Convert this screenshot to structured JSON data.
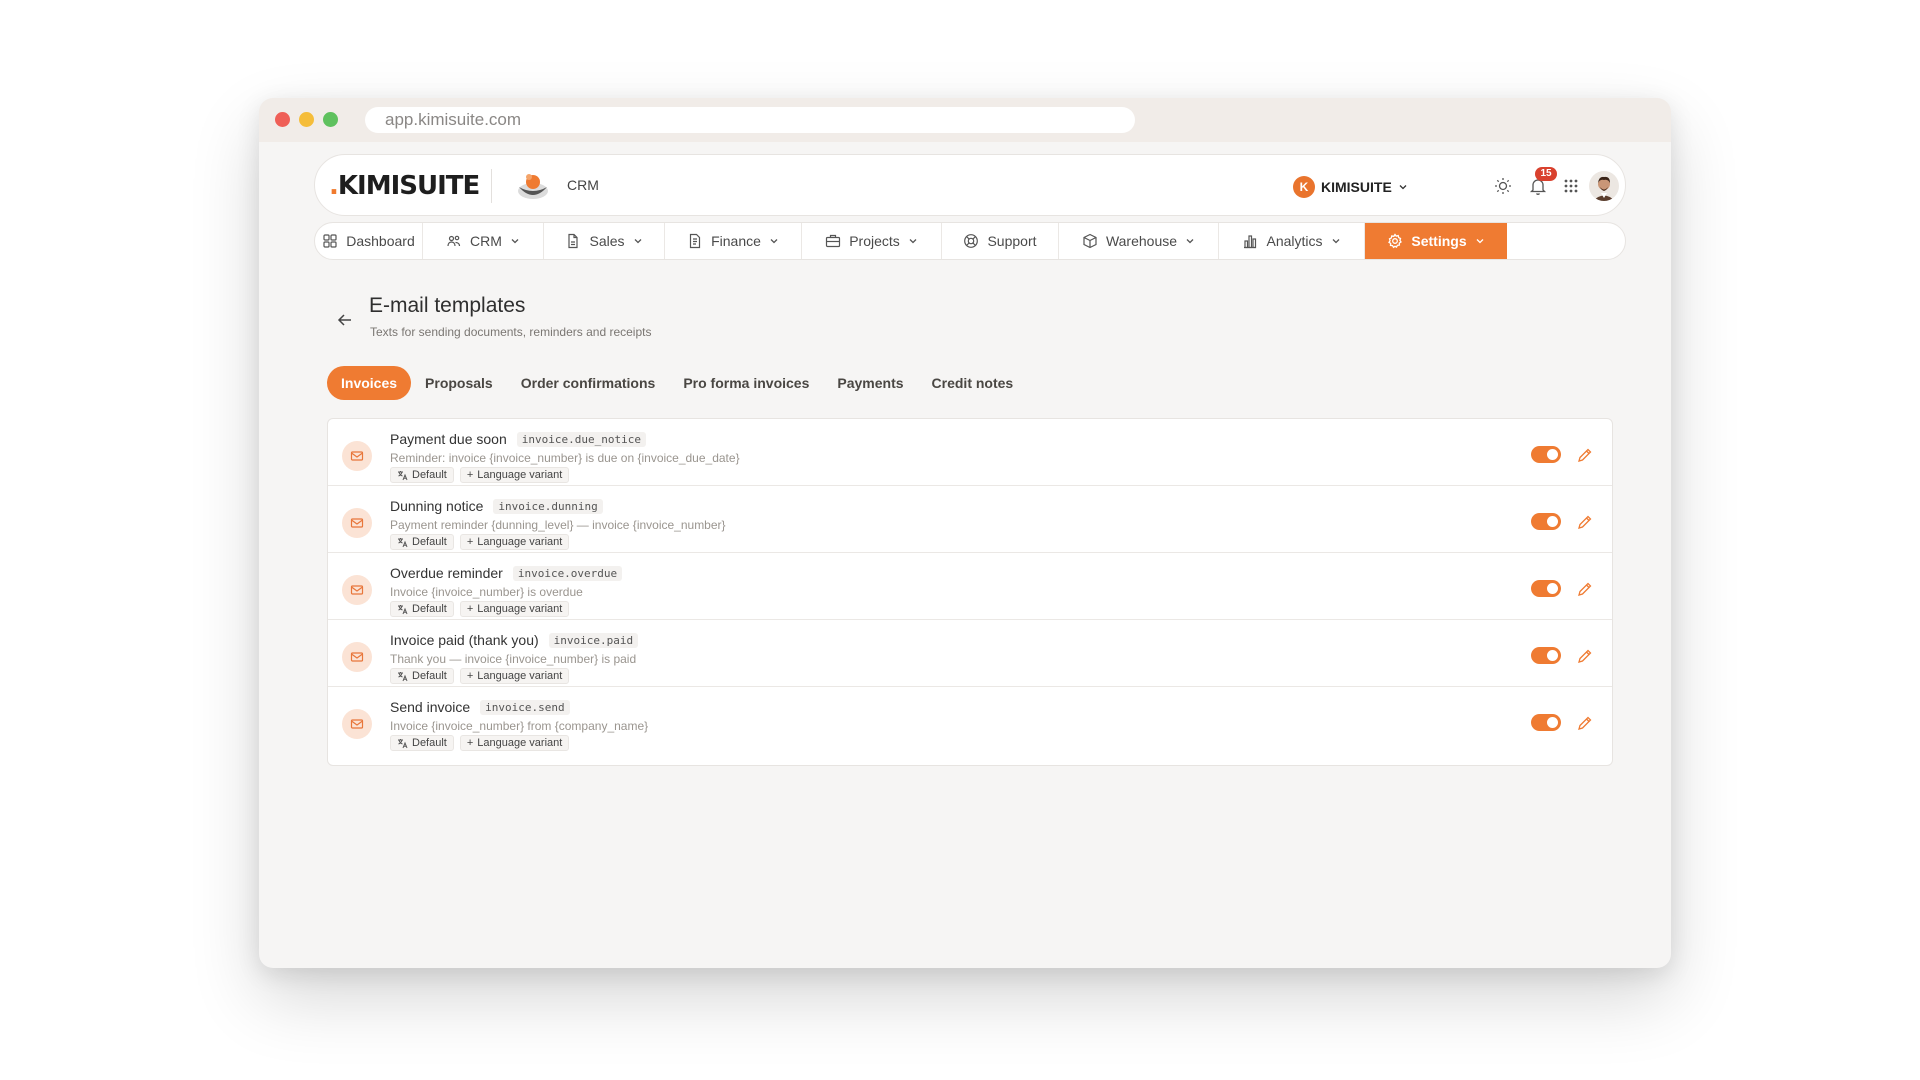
{
  "browser": {
    "url": "app.kimisuite.com"
  },
  "header": {
    "logo_dot": ".",
    "logo_text": "KIMISUITE",
    "app_label": "CRM",
    "tenant_initial": "K",
    "tenant_name": "KIMISUITE",
    "notification_count": "15"
  },
  "nav": {
    "items": [
      {
        "label": "Dashboard",
        "icon": "dashboard-icon",
        "dropdown": false
      },
      {
        "label": "CRM",
        "icon": "users-icon",
        "dropdown": true
      },
      {
        "label": "Sales",
        "icon": "document-icon",
        "dropdown": true
      },
      {
        "label": "Finance",
        "icon": "file-text-icon",
        "dropdown": true
      },
      {
        "label": "Projects",
        "icon": "briefcase-icon",
        "dropdown": true
      },
      {
        "label": "Support",
        "icon": "lifebuoy-icon",
        "dropdown": false
      },
      {
        "label": "Warehouse",
        "icon": "box-icon",
        "dropdown": true
      },
      {
        "label": "Analytics",
        "icon": "bar-chart-icon",
        "dropdown": true
      },
      {
        "label": "Settings",
        "icon": "gear-icon",
        "dropdown": true,
        "active": true
      }
    ]
  },
  "page": {
    "title": "E-mail templates",
    "subtitle": "Texts for sending documents, reminders and receipts"
  },
  "tabs": [
    {
      "label": "Invoices",
      "active": true
    },
    {
      "label": "Proposals"
    },
    {
      "label": "Order confirmations"
    },
    {
      "label": "Pro forma invoices"
    },
    {
      "label": "Payments"
    },
    {
      "label": "Credit notes"
    }
  ],
  "templates": [
    {
      "name": "Payment due soon",
      "code": "invoice.due_notice",
      "subject": "Reminder: invoice {invoice_number} is due on {invoice_due_date}",
      "default_label": "Default",
      "variant_label": "Language variant",
      "enabled": true
    },
    {
      "name": "Dunning notice",
      "code": "invoice.dunning",
      "subject": "Payment reminder {dunning_level} — invoice {invoice_number}",
      "default_label": "Default",
      "variant_label": "Language variant",
      "enabled": true
    },
    {
      "name": "Overdue reminder",
      "code": "invoice.overdue",
      "subject": "Invoice {invoice_number} is overdue",
      "default_label": "Default",
      "variant_label": "Language variant",
      "enabled": true
    },
    {
      "name": "Invoice paid (thank you)",
      "code": "invoice.paid",
      "subject": "Thank you — invoice {invoice_number} is paid",
      "default_label": "Default",
      "variant_label": "Language variant",
      "enabled": true
    },
    {
      "name": "Send invoice",
      "code": "invoice.send",
      "subject": "Invoice {invoice_number} from {company_name}",
      "default_label": "Default",
      "variant_label": "Language variant",
      "enabled": true
    }
  ],
  "colors": {
    "accent": "#ef7b32",
    "badge": "#d9412e",
    "icon_bg": "#fbe3d5"
  }
}
